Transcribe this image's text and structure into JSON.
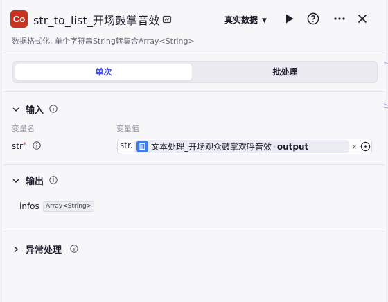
{
  "header": {
    "logo_text": "Co",
    "title": "str_to_list_开场鼓掌音效",
    "env_select": "真实数据",
    "description": "数据格式化, 单个字符串String转集合Array<String>"
  },
  "tabs": [
    {
      "label": "单次",
      "active": true
    },
    {
      "label": "批处理",
      "active": false
    }
  ],
  "input": {
    "section_title": "输入",
    "col_name": "变量名",
    "col_value": "变量值",
    "var_name": "str",
    "required_mark": "*",
    "type_prefix": "str.",
    "ref_node": "文本处理_开场观众鼓掌欢呼音效",
    "ref_separator": "·",
    "ref_output": "output",
    "clear_glyph": "×"
  },
  "output": {
    "section_title": "输出",
    "var_name": "infos",
    "var_type": "Array<String>"
  },
  "exception": {
    "section_title": "异常处理"
  },
  "colors": {
    "accent": "#4d53e8",
    "logo_bg": "#c8321e",
    "node_icon": "#3d7bf5",
    "required": "#e0344a"
  }
}
